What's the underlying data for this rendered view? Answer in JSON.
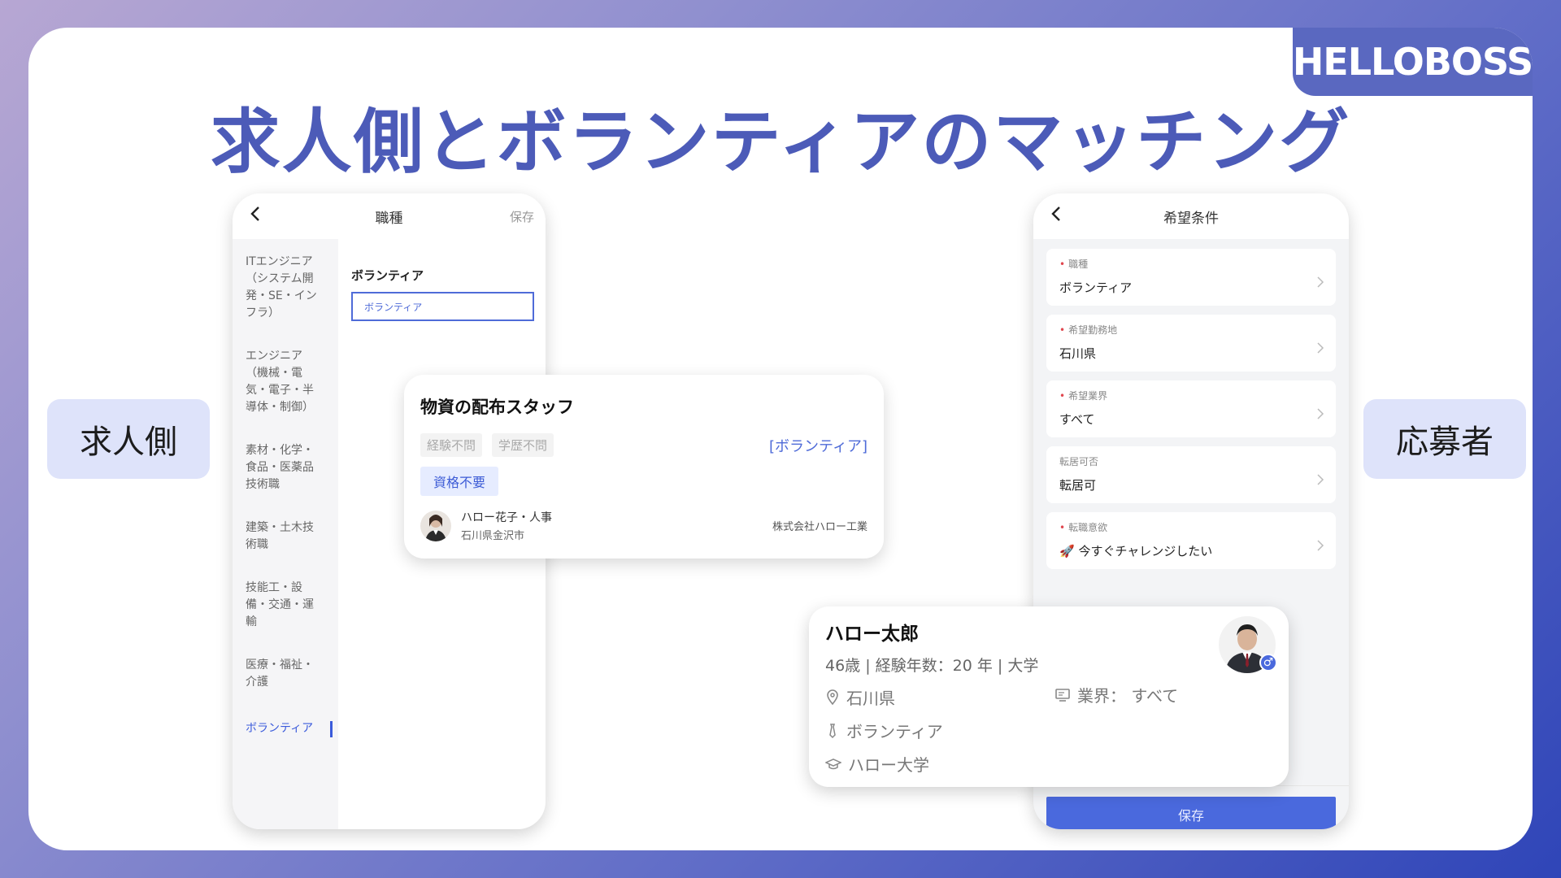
{
  "brand": "HELLOBOSS",
  "title": "求人側とボランティアのマッチング",
  "pills": {
    "left": "求人側",
    "right": "応募者"
  },
  "left_phone": {
    "header": "職種",
    "save": "保存",
    "categories": [
      "ITエンジニア（システム開発・SE・インフラ）",
      "エンジニア（機械・電気・電子・半導体・制御）",
      "素材・化学・食品・医薬品技術職",
      "建築・土木技術職",
      "技能工・設備・交通・運輸",
      "医療・福祉・介護"
    ],
    "active_category": "ボランティア",
    "sub_title": "ボランティア",
    "selected_chip": "ボランティア"
  },
  "job_card": {
    "title": "物資の配布スタッフ",
    "tags": [
      "経験不問",
      "学歴不問"
    ],
    "category": "[ボランティア]",
    "highlight_tag": "資格不要",
    "recruiter_name": "ハロー花子・人事",
    "recruiter_location": "石川県金沢市",
    "company": "株式会社ハロー工業"
  },
  "right_phone": {
    "header": "希望条件",
    "rows": [
      {
        "label": "職種",
        "value": "ボランティア",
        "required": true
      },
      {
        "label": "希望勤務地",
        "value": "石川県",
        "required": true
      },
      {
        "label": "希望業界",
        "value": "すべて",
        "required": true
      },
      {
        "label": "転居可否",
        "value": "転居可",
        "required": false
      },
      {
        "label": "転職意欲",
        "value": "🚀 今すぐチャレンジしたい",
        "required": true
      }
    ],
    "save": "保存"
  },
  "applicant": {
    "name": "ハロー太郎",
    "meta": "46歳 | 経験年数：20 年 | 大学",
    "location": "石川県",
    "industry": "業界：  すべて",
    "job": "ボランティア",
    "school": "ハロー大学",
    "gender_symbol": "♂"
  },
  "colors": {
    "accent": "#4a69dd",
    "title": "#4c5bb8",
    "pill_bg": "#dee3fa"
  }
}
